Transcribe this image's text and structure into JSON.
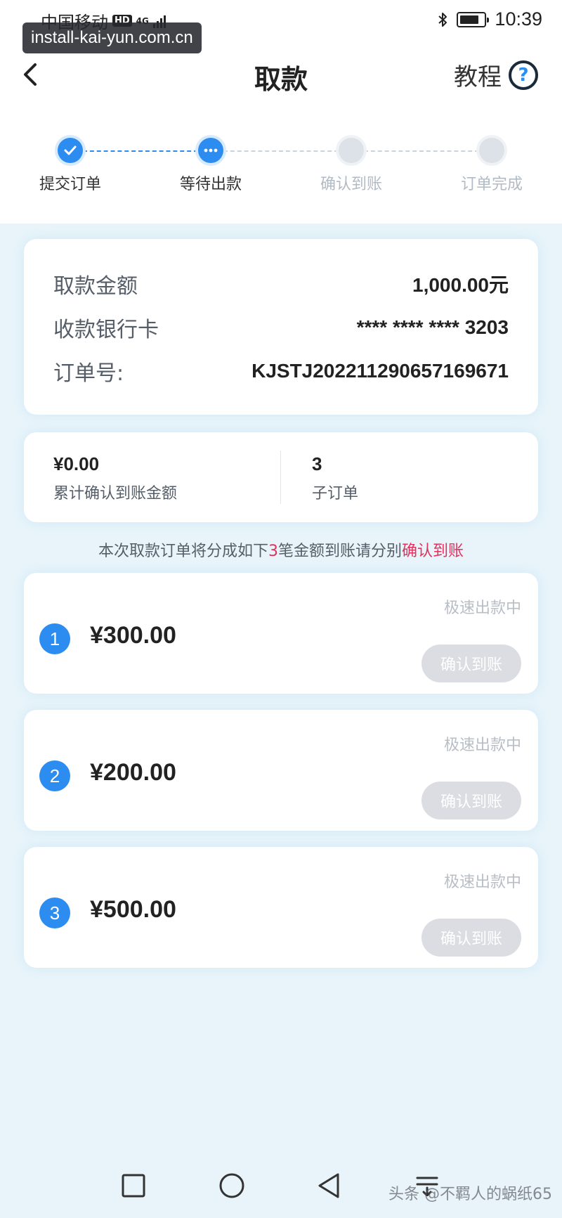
{
  "status_bar": {
    "carrier": "中国移动",
    "hd_badge": "HD",
    "network": "4G",
    "time": "10:39"
  },
  "url_overlay": "install-kai-yun.com.cn",
  "header": {
    "title": "取款",
    "tutorial_label": "教程",
    "help_glyph": "?"
  },
  "steps": [
    {
      "label": "提交订单",
      "state": "done"
    },
    {
      "label": "等待出款",
      "state": "current"
    },
    {
      "label": "确认到账",
      "state": "todo"
    },
    {
      "label": "订单完成",
      "state": "todo"
    }
  ],
  "order_info": {
    "amount_label": "取款金额",
    "amount_value": "1,000.00元",
    "card_label": "收款银行卡",
    "card_value": "**** **** **** 3203",
    "order_no_label": "订单号:",
    "order_no_value": "KJSTJ20221129065716967​1"
  },
  "summary": {
    "confirmed_amount": "¥0.00",
    "confirmed_label": "累计确认到账金额",
    "sub_count": "3",
    "sub_count_label": "子订单"
  },
  "notice": {
    "part1": "本次取款订单将分成如下",
    "count": "3",
    "part2": "笔金额到账请分别",
    "action": "确认到账"
  },
  "sub_orders": [
    {
      "index": "1",
      "amount": "¥300.00",
      "status": "极速出款中",
      "button": "确认到账"
    },
    {
      "index": "2",
      "amount": "¥200.00",
      "status": "极速出款中",
      "button": "确认到账"
    },
    {
      "index": "3",
      "amount": "¥500.00",
      "status": "极速出款中",
      "button": "确认到账"
    }
  ],
  "watermark": "头条 @不羁人的蜗纸65",
  "colors": {
    "primary": "#2d8cf0",
    "highlight": "#e0315d",
    "disabled_button": "#dcdde2",
    "background": "#e8f4fa"
  }
}
